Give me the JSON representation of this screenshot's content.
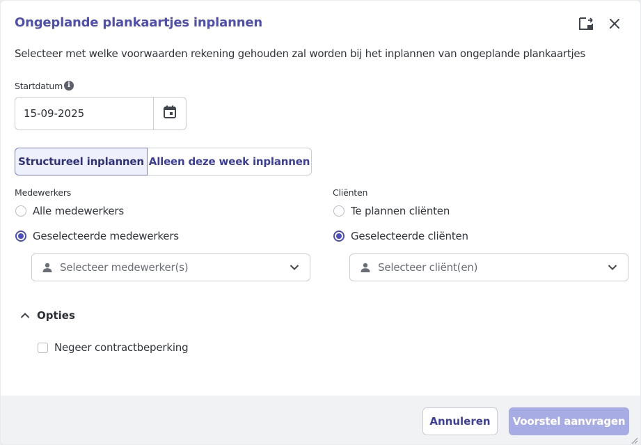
{
  "dialog": {
    "title": "Ongeplande plankaartjes inplannen",
    "description": "Selecteer met welke voorwaarden rekening gehouden zal worden bij het inplannen van ongeplande plankaartjes",
    "icons": {
      "expand": "expand-icon",
      "close": "close-icon"
    }
  },
  "startdatum": {
    "label": "Startdatum",
    "info_icon": "info-icon",
    "value": "15-09-2025",
    "calendar_icon": "calendar-icon"
  },
  "mode_toggle": {
    "options": [
      "Structureel inplannen",
      "Alleen deze week inplannen"
    ],
    "selected": "Structureel inplannen"
  },
  "medewerkers": {
    "label": "Medewerkers",
    "options": [
      "Alle medewerkers",
      "Geselecteerde medewerkers"
    ],
    "selected": "Geselecteerde medewerkers",
    "select_placeholder": "Selecteer medewerker(s)"
  },
  "clienten": {
    "label": "Cliënten",
    "options": [
      "Te plannen cliënten",
      "Geselecteerde cliënten"
    ],
    "selected": "Geselecteerde cliënten",
    "select_placeholder": "Selecteer cliënt(en)"
  },
  "opties": {
    "label": "Opties",
    "expanded": true,
    "checkbox_label": "Negeer contractbeperking",
    "checkbox_checked": false
  },
  "footer": {
    "cancel_label": "Annuleren",
    "submit_label": "Voorstel aanvragen"
  },
  "colors": {
    "accent": "#4f4fb1",
    "radio_checked": "#4b4dc2",
    "primary_disabled": "#a8ace4",
    "footer_bg": "#f1f2f4"
  }
}
